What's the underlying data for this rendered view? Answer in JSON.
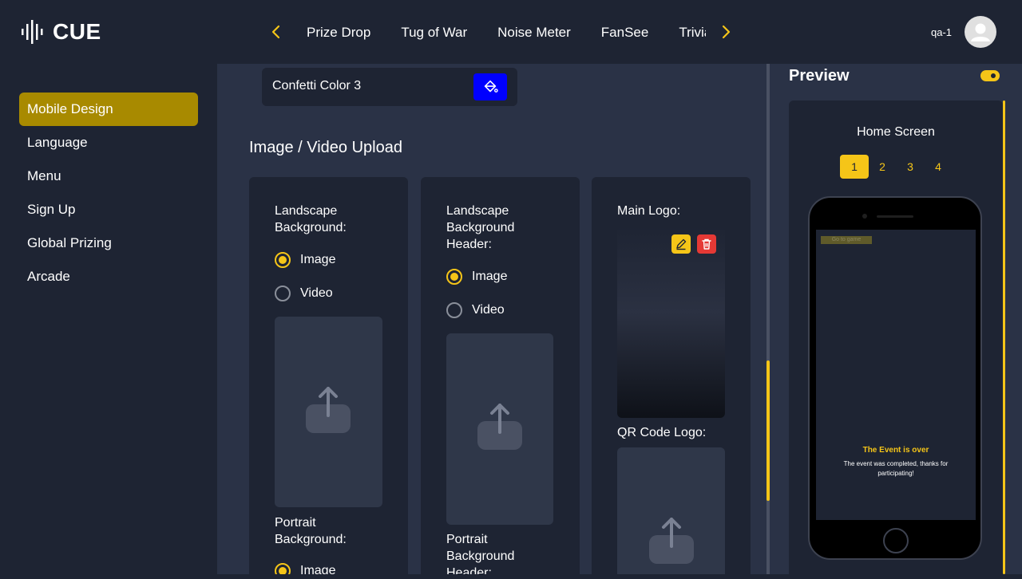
{
  "app": {
    "brand": "CUE"
  },
  "nav": {
    "tabs": [
      "Prize Drop",
      "Tug of War",
      "Noise Meter",
      "FanSee",
      "Trivia"
    ]
  },
  "user": {
    "name": "qa-1"
  },
  "sidebar": {
    "items": [
      "Mobile Design",
      "Language",
      "Menu",
      "Sign Up",
      "Global Prizing",
      "Arcade"
    ],
    "active": "Mobile Design"
  },
  "main": {
    "confetti_field": {
      "label": "Confetti Color 3",
      "color": "#0000ff"
    },
    "section_title": "Image / Video Upload",
    "cards": [
      {
        "label": "Landscape Background:",
        "radio_image": "Image",
        "radio_video": "Video",
        "selected": "Image",
        "second_label": "Portrait Background:",
        "second_radio": "Image"
      },
      {
        "label": "Landscape Background Header:",
        "radio_image": "Image",
        "radio_video": "Video",
        "selected": "Image",
        "second_label": "Portrait Background Header:"
      },
      {
        "label": "Main Logo:",
        "second_label": "QR Code Logo:"
      }
    ]
  },
  "preview": {
    "title": "Preview",
    "toggle_on": true,
    "screen_title": "Home Screen",
    "pages": [
      "1",
      "2",
      "3",
      "4"
    ],
    "active_page": "1",
    "phone": {
      "go_button": "Go to game",
      "event_title": "The Event is over",
      "event_text": "The event was completed, thanks for participating!"
    }
  },
  "colors": {
    "accent": "#f5c518",
    "sidebar_active": "#a88a00",
    "bg": "#1e2433",
    "panel": "#2a3246",
    "swatch": "#0000ff",
    "delete": "#e53935"
  }
}
